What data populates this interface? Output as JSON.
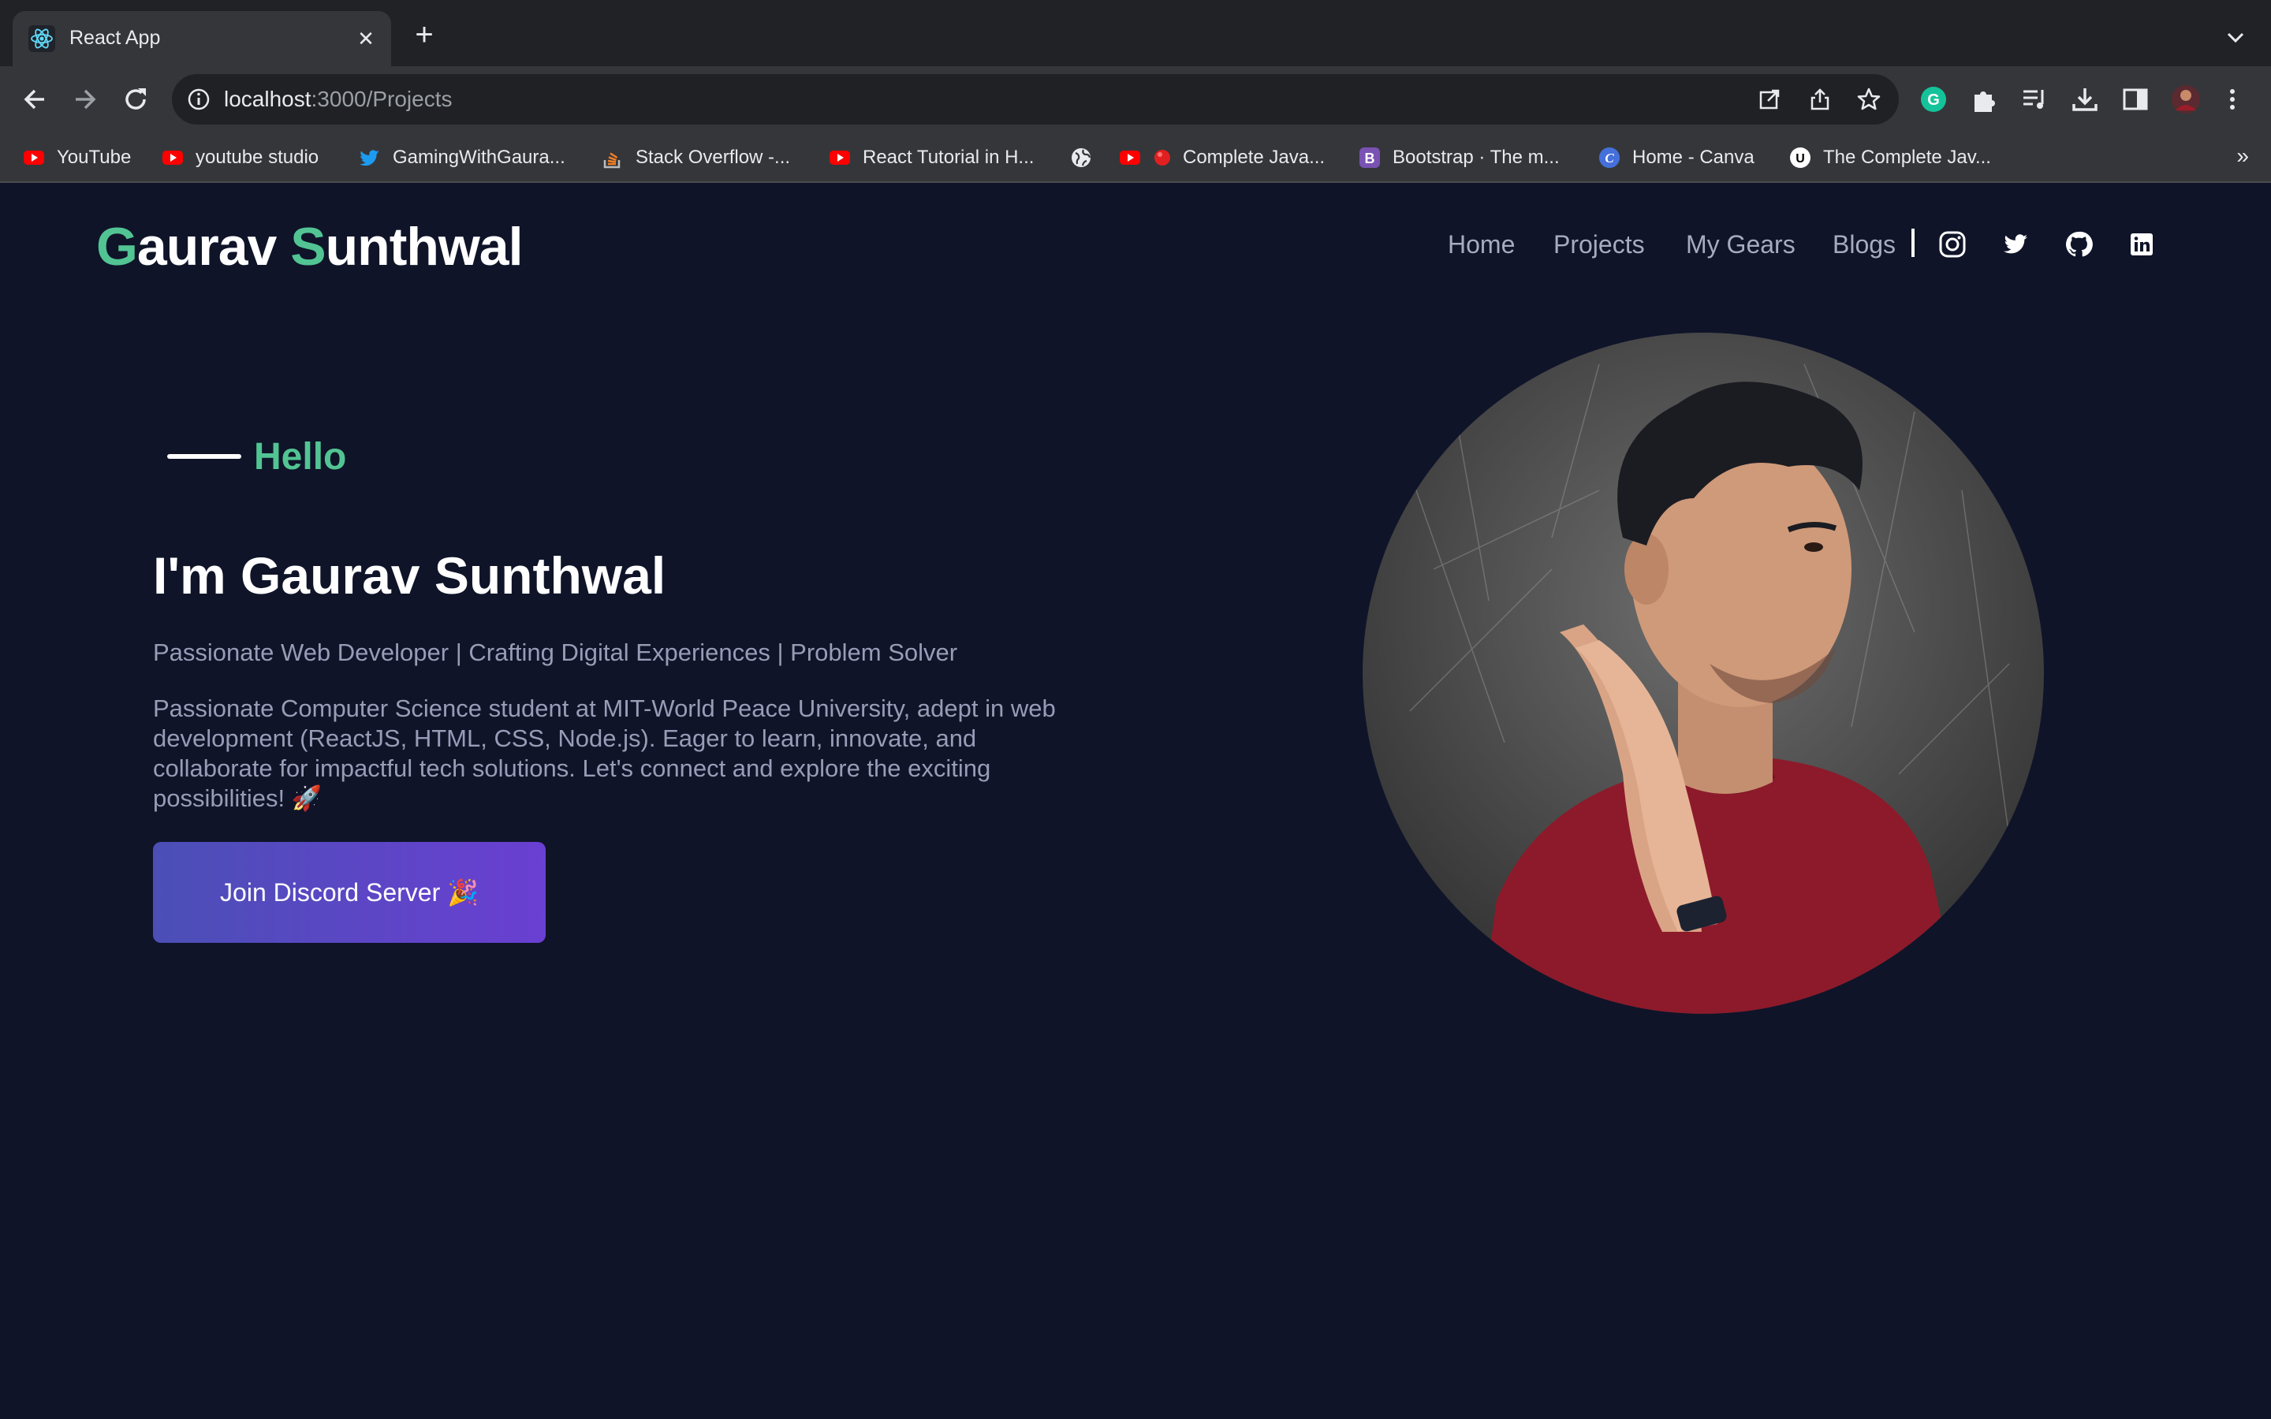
{
  "browser": {
    "tab_title": "React App",
    "url_host": "localhost",
    "url_path": ":3000/Projects",
    "bookmarks": [
      "YouTube",
      "youtube studio",
      "GamingWithGaura...",
      "Stack Overflow -...",
      "React Tutorial in H...",
      "",
      "Complete Java...",
      "Bootstrap · The m...",
      "Home - Canva",
      "The Complete Jav..."
    ],
    "more_bookmarks": "»"
  },
  "site": {
    "logo_first_initial": "G",
    "logo_first_rest": "aurav ",
    "logo_last_initial": "S",
    "logo_last_rest": "unthwal",
    "nav": [
      "Home",
      "Projects",
      "My Gears",
      "Blogs"
    ],
    "social_icons": [
      "instagram-icon",
      "twitter-icon",
      "github-icon",
      "linkedin-icon"
    ],
    "accent_color": "#52c493",
    "background_color": "#0f1429"
  },
  "hero": {
    "greeting": "Hello",
    "headline": "I'm Gaurav Sunthwal",
    "tagline": "Passionate Web Developer | Crafting Digital Experiences | Problem Solver",
    "bio": "Passionate Computer Science student at MIT-World Peace University, adept in web development (ReactJS, HTML, CSS, Node.js). Eager to learn, innovate, and collaborate for impactful tech solutions. Let's connect and explore the exciting possibilities! 🚀",
    "cta_label": "Join Discord Server 🎉"
  }
}
